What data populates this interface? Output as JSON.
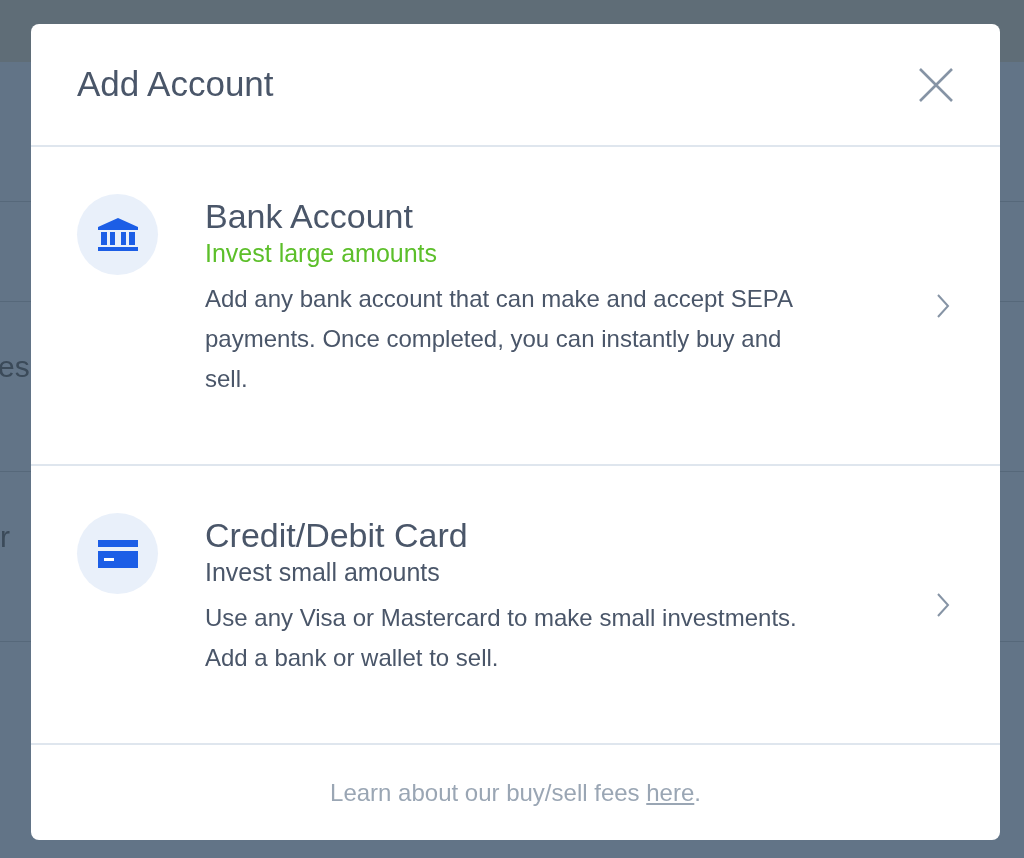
{
  "background": {
    "fragments": [
      "es",
      "r"
    ]
  },
  "dialog": {
    "title": "Add Account",
    "options": [
      {
        "kind": "bank",
        "title": "Bank Account",
        "subtitle": "Invest large amounts",
        "accent": true,
        "description": "Add any bank account that can make and accept SEPA payments. Once completed, you can instantly buy and sell."
      },
      {
        "kind": "card",
        "title": "Credit/Debit Card",
        "subtitle": "Invest small amounts",
        "accent": false,
        "description": "Use any Visa or Mastercard to make small investments. Add a bank or wallet to sell."
      }
    ],
    "footer": {
      "text": "Learn about our buy/sell fees",
      "link": "here",
      "end": "."
    }
  }
}
